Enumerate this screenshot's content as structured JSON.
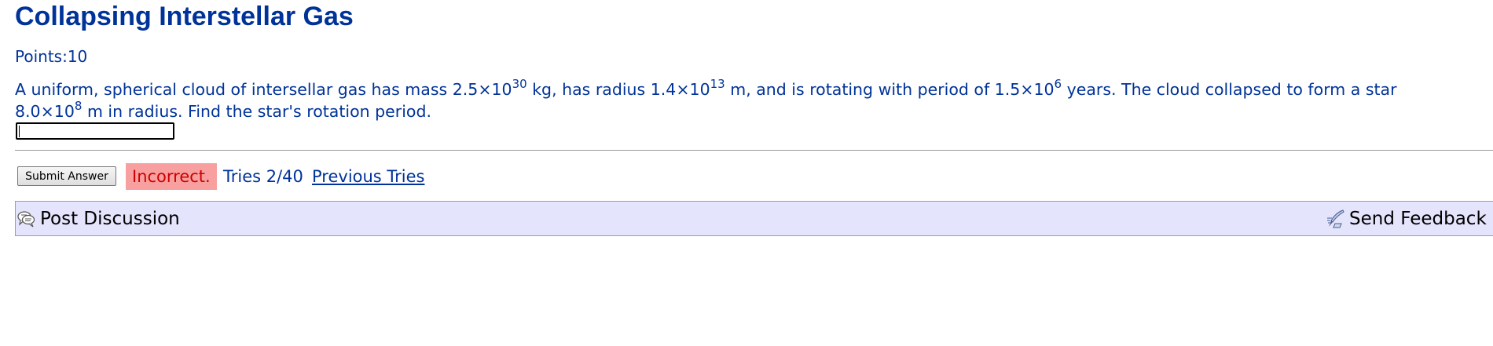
{
  "problem": {
    "title": "Collapsing Interstellar Gas",
    "points_label": "Points:10",
    "question": {
      "line1": {
        "p1": "A uniform, spherical cloud of intersellar gas has mass 2.5×10",
        "e1": "30",
        "p2": " kg, has radius 1.4×10",
        "e2": "13",
        "p3": " m, and is rotating with period of 1.5×10",
        "e3": "6",
        "p4": " years. The cloud collapsed to form a star"
      },
      "line2": {
        "p1": "8.0×10",
        "e1": "8",
        "p2": " m in radius. Find the star's rotation period."
      }
    },
    "answer_value": ""
  },
  "submission": {
    "submit_label": "Submit Answer",
    "status": "Incorrect.",
    "tries": "Tries 2/40",
    "previous_tries_label": "Previous Tries"
  },
  "discussion": {
    "post_label": "Post Discussion",
    "feedback_label": "Send Feedback",
    "post_icon": "speech-bubble-icon",
    "feedback_icon": "quill-pen-icon"
  },
  "colors": {
    "text": "#003399",
    "incorrect_bg": "#f8a0a0",
    "incorrect_text": "#cc0000",
    "discussion_bg": "#e4e4fc"
  }
}
